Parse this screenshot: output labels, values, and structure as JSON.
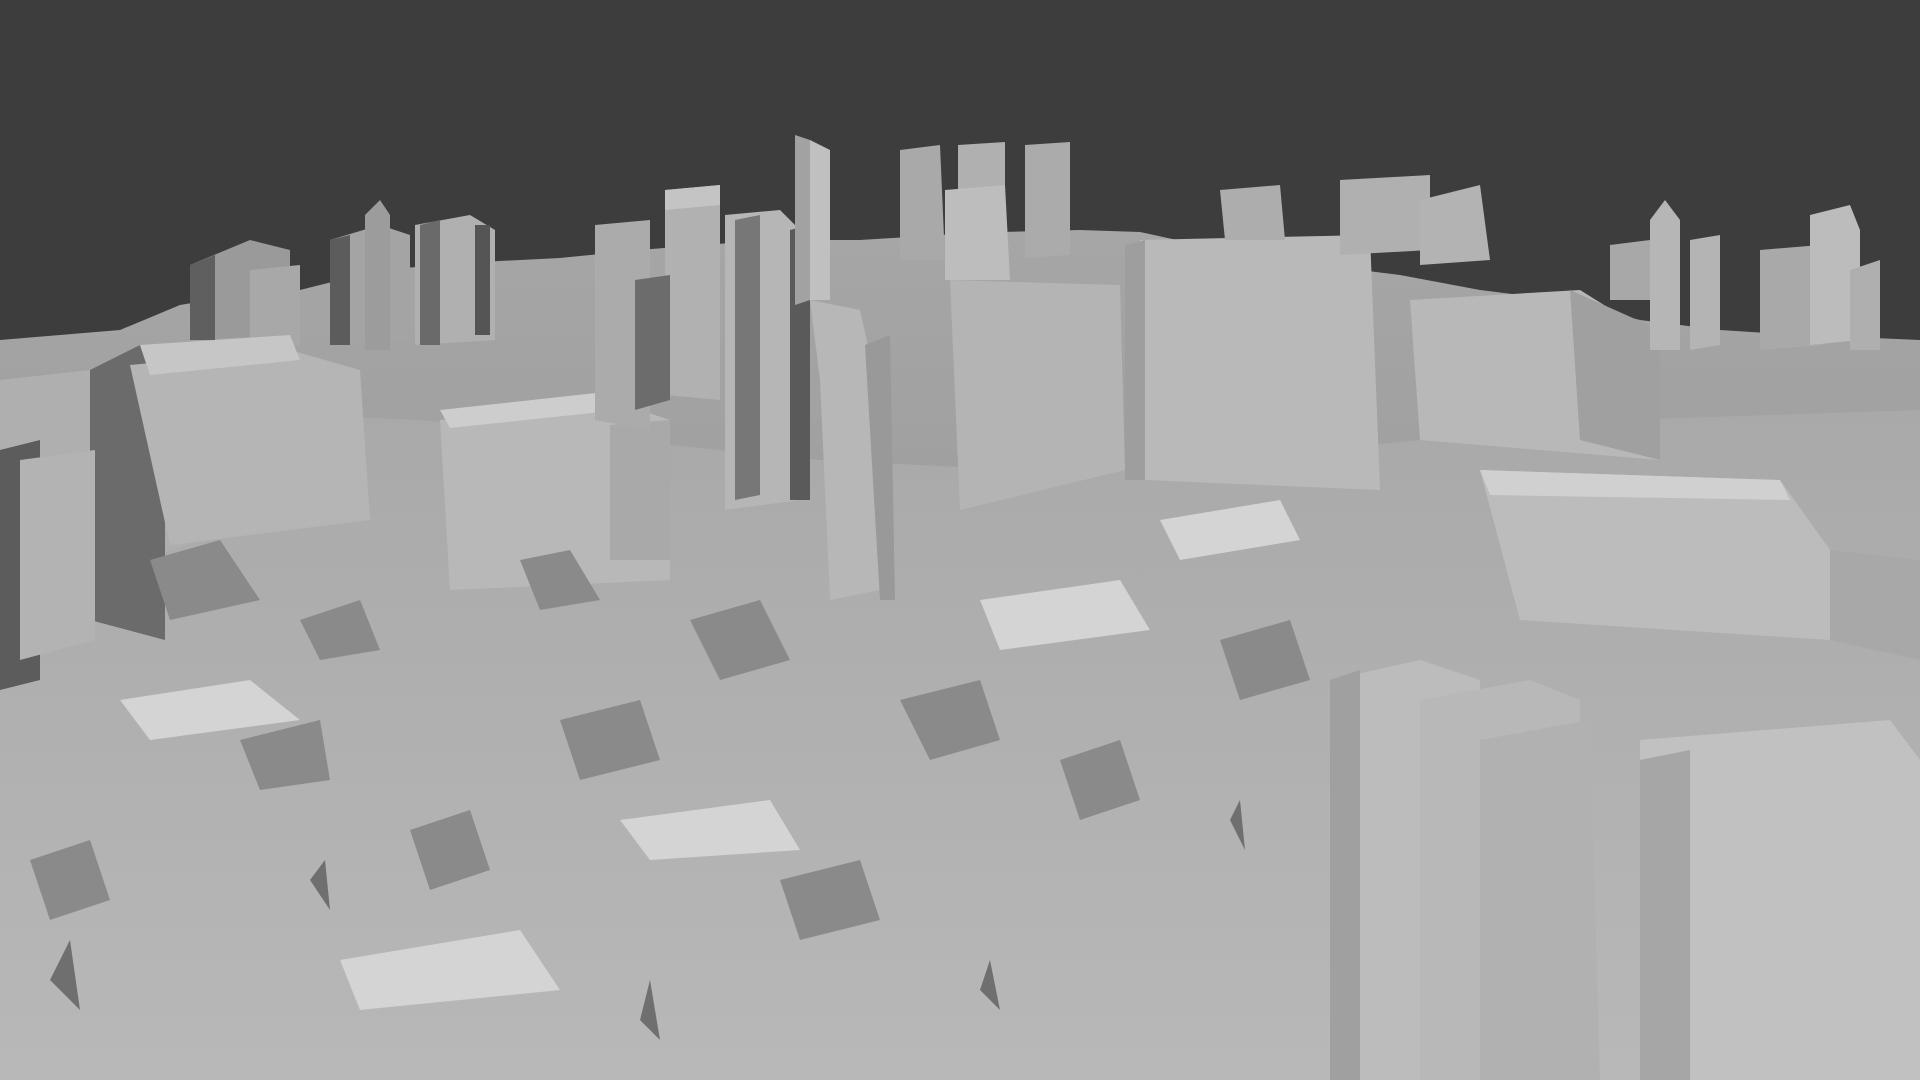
{
  "viewport": {
    "background_color": "#3d3d3d",
    "mesh_color": "#b9b9b9",
    "shadow_color": "#6a6a6a",
    "highlight_color": "#d0d0d0"
  }
}
